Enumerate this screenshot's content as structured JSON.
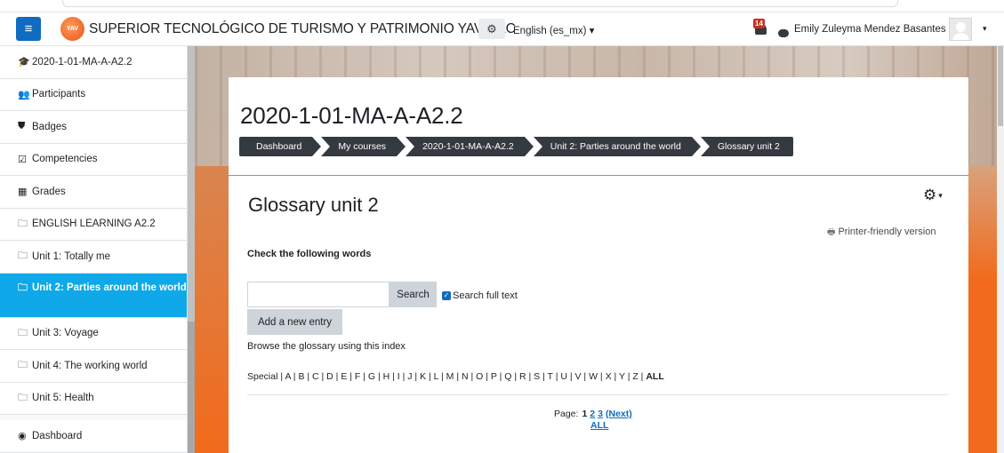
{
  "navbar": {
    "menu_icon": "≡",
    "logo_text": "YAV",
    "site_name": "SUPERIOR TECNOLÓGICO DE TURISMO Y PATRIMONIO YAVIRAC",
    "language_icon": "gears-icon",
    "language": "English (es_mx) ▾",
    "notification_count": "14",
    "user_name": "Emily Zuleyma Mendez Basantes",
    "user_menu_caret": "▾"
  },
  "sidebar": {
    "items": [
      {
        "icon": "graduation-cap-icon",
        "glyph": "🎓",
        "label": "2020-1-01-MA-A-A2.2"
      },
      {
        "icon": "users-icon",
        "glyph": "👥",
        "label": "Participants"
      },
      {
        "icon": "shield-icon",
        "glyph": "⛊",
        "label": "Badges"
      },
      {
        "icon": "check-square-icon",
        "glyph": "☑",
        "label": "Competencies"
      },
      {
        "icon": "table-icon",
        "glyph": "▦",
        "label": "Grades"
      },
      {
        "icon": "folder-icon",
        "glyph": "🗀",
        "label": "ENGLISH LEARNING A2.2"
      },
      {
        "icon": "folder-icon",
        "glyph": "🗀",
        "label": "Unit 1: Totally me"
      },
      {
        "icon": "folder-icon",
        "glyph": "🗀",
        "label": "Unit 2: Parties around the world",
        "active": true
      },
      {
        "icon": "folder-icon",
        "glyph": "🗀",
        "label": "Unit 3: Voyage"
      },
      {
        "icon": "folder-icon",
        "glyph": "🗀",
        "label": "Unit 4: The working world"
      },
      {
        "icon": "folder-icon",
        "glyph": "🗀",
        "label": "Unit 5: Health"
      },
      {
        "icon": "tachometer-icon",
        "glyph": "◉",
        "label": "Dashboard"
      }
    ]
  },
  "header": {
    "title": "2020-1-01-MA-A-A2.2",
    "breadcrumb": [
      "Dashboard",
      "My courses",
      "2020-1-01-MA-A-A2.2",
      "Unit 2: Parties around the world",
      "Glossary unit 2"
    ]
  },
  "glossary": {
    "title": "Glossary unit 2",
    "gear_icon": "⚙",
    "printer_link": "Printer-friendly version",
    "intro": "Check the following words",
    "search_value": "",
    "search_button": "Search",
    "full_text_label": "Search full text",
    "full_text_checked": true,
    "add_entry_button": "Add a new entry",
    "browse_text": "Browse the glossary using this index",
    "index_prefix": "Special",
    "letters": [
      "A",
      "B",
      "C",
      "D",
      "E",
      "F",
      "G",
      "H",
      "I",
      "J",
      "K",
      "L",
      "M",
      "N",
      "O",
      "P",
      "Q",
      "R",
      "S",
      "T",
      "U",
      "V",
      "W",
      "X",
      "Y",
      "Z"
    ],
    "index_all": "ALL",
    "paging": {
      "label": "Page:",
      "current": "1",
      "pages": [
        "2",
        "3"
      ],
      "next": "(Next)",
      "all": "ALL"
    }
  },
  "colors": {
    "brand_blue": "#0f6cbf",
    "active_nav": "#0fa8e8",
    "breadcrumb_bg": "#343a40",
    "accent_orange": "#f26a1b",
    "notification_red": "#ca3120"
  }
}
